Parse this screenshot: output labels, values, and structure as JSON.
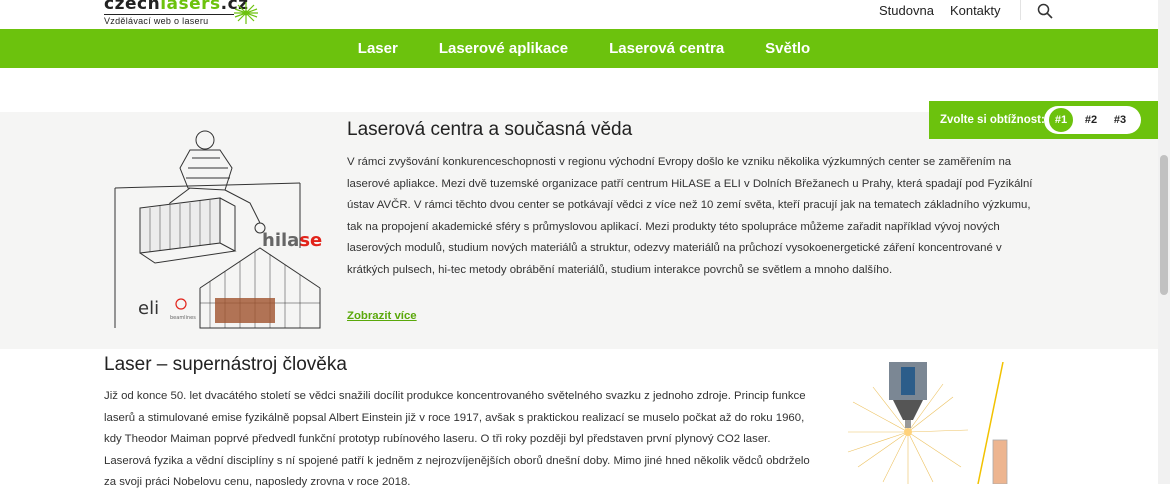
{
  "header": {
    "logo_prefix": "czech",
    "logo_highlight": "lasers",
    "logo_suffix": ".cz",
    "logo_tagline": "Vzdělávací web o laseru",
    "top_nav": [
      "Studovna",
      "Kontakty"
    ],
    "search_icon": "search-icon"
  },
  "main_nav": [
    "Laser",
    "Laserové aplikace",
    "Laserová centra",
    "Světlo"
  ],
  "difficulty": {
    "label": "Zvolte si obtížnost:",
    "options": [
      "#1",
      "#2",
      "#3"
    ],
    "selected": "#1"
  },
  "section_centers": {
    "title": "Laserová centra a současná věda",
    "body": "V rámci zvyšování konkurenceschopnosti v regionu východní Evropy došlo ke vzniku několika výzkumných center se zaměřením na laserové apliakce. Mezi dvě tuzemské organizace patří centrum HiLASE a ELI v Dolních Břežanech u Prahy, která spadají pod Fyzikální ústav AVČR. V rámci těchto dvou center se potkávají vědci z více než 10 zemí světa, kteří pracují jak na tematech základního výzkumu, tak na propojení akademické sféry s průmyslovou aplikací. Mezi produkty této spolupráce můžeme zařadit například vývoj nových laserových modulů, studium nových materiálů a struktur, odezvy materiálů na průchozí vysokoenergetické záření koncentrované v krátkých pulsech, hi-tec metody obrábění materiálů, studium interakce povrchů se světlem a mnoho dalšího.",
    "more_link": "Zobrazit více",
    "logo_hilase_a": "hila",
    "logo_hilase_b": "se",
    "logo_eli": "eli",
    "logo_beamlines": "beamlines"
  },
  "section_laser": {
    "title": "Laser – supernástroj člověka",
    "body": "Již od konce 50. let dvacátého století se vědci snažili docílit produkce koncentrovaného světelného svazku z jednoho zdroje. Princip funkce laserů a stimulované emise fyzikálně popsal Albert Einstein již v roce 1917, avšak s praktickou realizací se muselo počkat až do roku 1960, kdy Theodor Maiman poprvé předvedl funkční prototyp rubínového laseru. O tři roky později byl představen první plynový CO2 laser. Laserová fyzika a vědní disciplíny s ní spojené patří k jedněm z nejrozvíjenějších oborů dnešní doby. Mimo jiné hned několik vědců obdrželo za svoji práci Nobelovu cenu, naposledy zrovna v roce 2018."
  },
  "colors": {
    "brand_green": "#6cc20d",
    "gray_bg": "#f5f5f4",
    "text": "#222222"
  }
}
